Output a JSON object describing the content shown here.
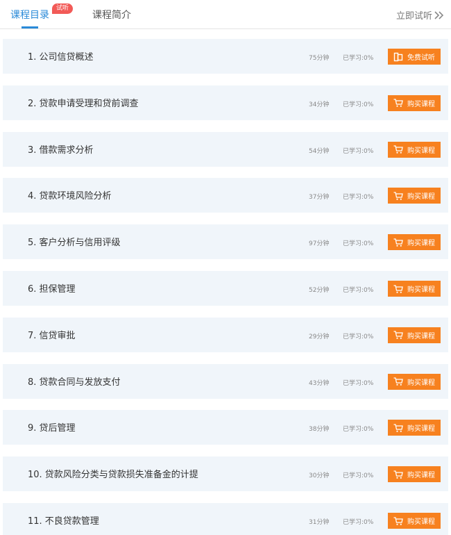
{
  "tabs": {
    "catalog": "课程目录",
    "trial_badge": "试听",
    "intro": "课程简介",
    "listen_now": "立即试听"
  },
  "colors": {
    "accent": "#2a8ad8",
    "badge": "#f25a57",
    "button": "#f7811f",
    "row_bg": "#f0f5fa"
  },
  "lessons": [
    {
      "title": "1. 公司信贷概述",
      "duration": "75分钟",
      "progress": "已学习:0%",
      "button": "免费试听",
      "icon": "free-trial-icon"
    },
    {
      "title": "2. 贷款申请受理和贷前调查",
      "duration": "34分钟",
      "progress": "已学习:0%",
      "button": "购买课程",
      "icon": "cart-icon"
    },
    {
      "title": "3. 借款需求分析",
      "duration": "54分钟",
      "progress": "已学习:0%",
      "button": "购买课程",
      "icon": "cart-icon"
    },
    {
      "title": "4. 贷款环境风险分析",
      "duration": "37分钟",
      "progress": "已学习:0%",
      "button": "购买课程",
      "icon": "cart-icon"
    },
    {
      "title": "5. 客户分析与信用评级",
      "duration": "97分钟",
      "progress": "已学习:0%",
      "button": "购买课程",
      "icon": "cart-icon"
    },
    {
      "title": "6. 担保管理",
      "duration": "52分钟",
      "progress": "已学习:0%",
      "button": "购买课程",
      "icon": "cart-icon"
    },
    {
      "title": "7. 信贷审批",
      "duration": "29分钟",
      "progress": "已学习:0%",
      "button": "购买课程",
      "icon": "cart-icon"
    },
    {
      "title": "8. 贷款合同与发放支付",
      "duration": "43分钟",
      "progress": "已学习:0%",
      "button": "购买课程",
      "icon": "cart-icon"
    },
    {
      "title": "9. 贷后管理",
      "duration": "38分钟",
      "progress": "已学习:0%",
      "button": "购买课程",
      "icon": "cart-icon"
    },
    {
      "title": "10. 贷款风险分类与贷款损失准备金的计提",
      "duration": "30分钟",
      "progress": "已学习:0%",
      "button": "购买课程",
      "icon": "cart-icon"
    },
    {
      "title": "11. 不良贷款管理",
      "duration": "31分钟",
      "progress": "已学习:0%",
      "button": "购买课程",
      "icon": "cart-icon"
    }
  ]
}
